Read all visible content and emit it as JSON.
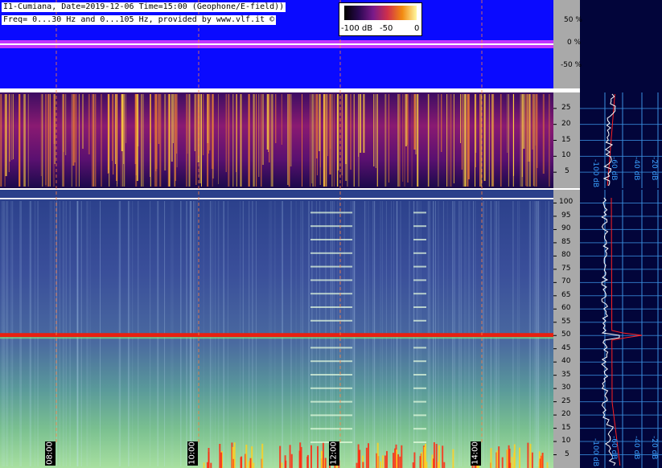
{
  "header": {
    "line1": "I1-Cumiana, Date=2019-12-06 Time=15:00 (Geophone/E-field))",
    "line2": "Freq= 0...30 Hz and 0...105 Hz, provided by www.vlf.it ©"
  },
  "colorbar": {
    "left_label": "-100 dB",
    "mid_label": "-50",
    "right_label": "0"
  },
  "colors": {
    "waveform_bg": "#0a0aff",
    "waveform_trace": "#ff44ff",
    "right_panel_bg": "#02053a",
    "grid_line": "#3a8fe0",
    "time_marker": "#ff8040",
    "spectrum_avg": "#ff2020",
    "spectrum_peak": "#ffffff"
  },
  "chart_data": [
    {
      "type": "line",
      "panel": "waveform",
      "y_ticks": [
        "50 %",
        "0 %",
        "-50 %"
      ],
      "ylim": [
        -100,
        100
      ],
      "ylabel": ""
    },
    {
      "type": "heatmap",
      "panel": "low-frequency spectrogram",
      "y_ticks": [
        5,
        10,
        15,
        20,
        25
      ],
      "ylim": [
        0,
        30
      ],
      "unit": "Hz"
    },
    {
      "type": "heatmap",
      "panel": "spectrogram",
      "y_ticks": [
        5,
        10,
        15,
        20,
        25,
        30,
        35,
        40,
        45,
        50,
        55,
        60,
        65,
        70,
        75,
        80,
        85,
        90,
        95,
        100
      ],
      "ylim": [
        0,
        105
      ],
      "x_ticks": [
        "08:00",
        "10:00",
        "12:00",
        "14:00"
      ],
      "dominant_line_hz": 50
    },
    {
      "type": "line",
      "panel": "spectrum profile (0-30 Hz)",
      "x_ticks": [
        "-100 dB",
        "-60 dB",
        "-40 dB",
        "-20 dB"
      ]
    },
    {
      "type": "line",
      "panel": "spectrum profile (0-105 Hz)",
      "x_ticks": [
        "-100 dB",
        "-60 dB",
        "-40 dB",
        "-20 dB"
      ]
    }
  ]
}
